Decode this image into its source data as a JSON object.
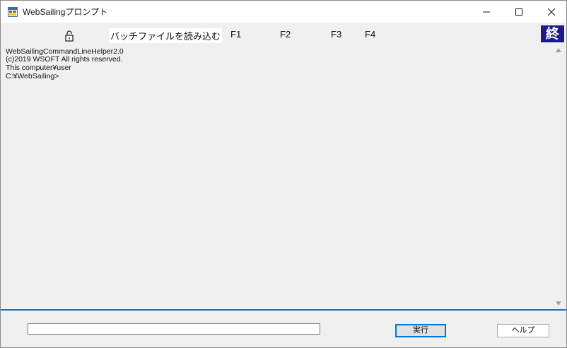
{
  "window": {
    "title": "WebSailingプロンプト",
    "icons": {
      "app": "app-window-icon",
      "minimize": "minimize-icon",
      "maximize": "maximize-icon",
      "close": "close-icon"
    }
  },
  "toolbar": {
    "lock_icon": "lock-open-icon",
    "batch_label": "バッチファイルを読み込む",
    "f1_label": "F1",
    "f2_label": "F2",
    "f3_label": "F3",
    "f4_label": "F4",
    "end_label": "終",
    "end_color": "#1d1a8c"
  },
  "console": {
    "lines": [
      "WebSailingCommandLineHelper2.0",
      "(c)2019 WSOFT All rights reserved.",
      "This computer¥user",
      "C:¥WebSailing>"
    ]
  },
  "bottom": {
    "input_value": "",
    "run_label": "実行",
    "help_label": "ヘルプ"
  },
  "colors": {
    "divider": "#1f6fc0",
    "accent": "#0078d7"
  }
}
